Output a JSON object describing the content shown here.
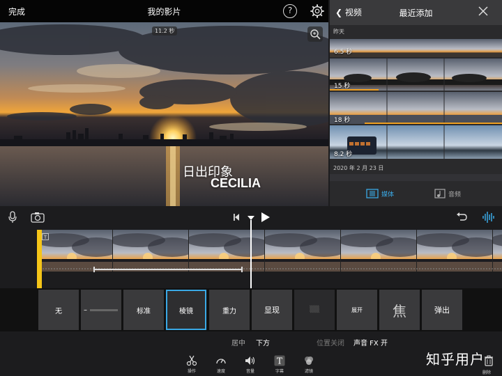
{
  "viewer": {
    "done_label": "完成",
    "title": "我的影片",
    "help_label": "?",
    "duration_badge": "11.2 秒",
    "overlay_line1": "日出印象",
    "overlay_line2": "CECILIA"
  },
  "browser": {
    "back_label": "视频",
    "title": "最近添加",
    "section_yesterday": "昨天",
    "section_date": "2020 年 2 月 23 日",
    "clips": [
      {
        "duration": "6.5 秒"
      },
      {
        "duration": "15 秒"
      },
      {
        "duration": "18 秒"
      },
      {
        "duration": "8.2 秒"
      }
    ],
    "tabs": {
      "media": "媒体",
      "audio": "音频"
    }
  },
  "title_styles": [
    "无",
    "",
    "标准",
    "棱镜",
    "重力",
    "显现",
    "",
    "展开",
    "焦",
    "弹出"
  ],
  "options": {
    "align_center": "居中",
    "align_bottom": "下方",
    "location_off": "位置关闭",
    "sound_fx": "声音 FX 开"
  },
  "bottom_tools": {
    "actions": "操作",
    "speed": "速度",
    "volume": "音量",
    "titles": "字幕",
    "filters": "滤镜",
    "delete": "删除"
  },
  "watermark": "知乎用户",
  "colors": {
    "accent": "#3aa9e6",
    "clip_handle": "#f5c518",
    "used_marker": "#f0a020"
  }
}
